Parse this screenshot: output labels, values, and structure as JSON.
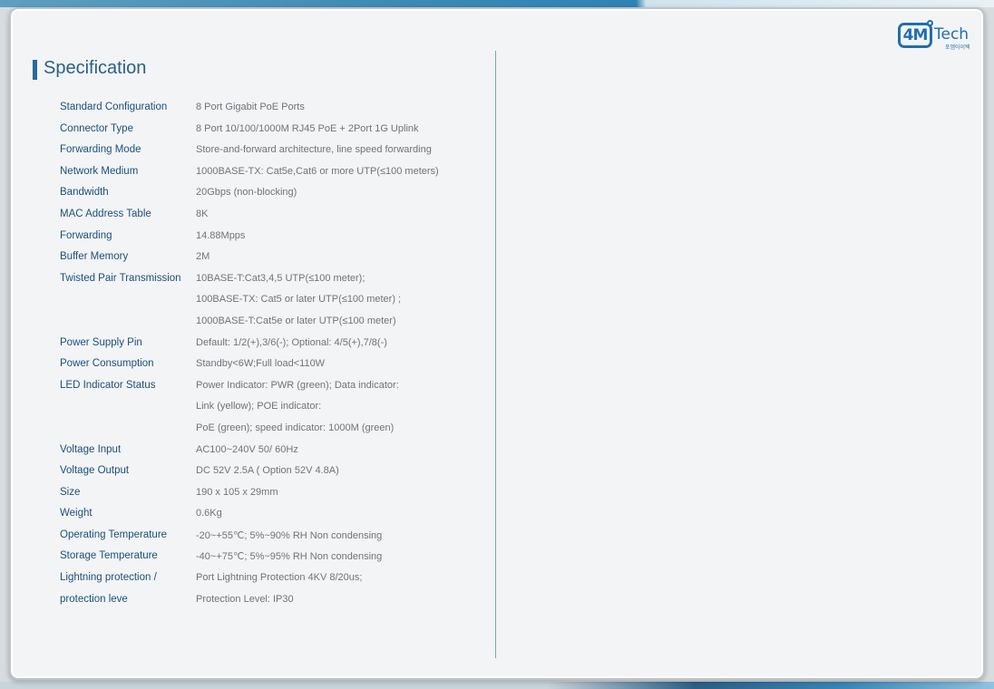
{
  "brand": {
    "logo_mark": "4M",
    "logo_text": "Tech",
    "logo_sub": "포엠아이텍"
  },
  "title": "Specification",
  "colors": {
    "accent": "#2a6a9a",
    "label": "#1d4f7c",
    "value": "#6f7479",
    "divider": "#6fa6cf"
  },
  "specs": [
    {
      "label": "Standard Configuration",
      "value": "8 Port Gigabit PoE Ports"
    },
    {
      "label": "Connector Type",
      "value": "8 Port 10/100/1000M  RJ45 PoE + 2Port 1G Uplink"
    },
    {
      "label": "Forwarding Mode",
      "value": "Store-and-forward architecture, line speed forwarding"
    },
    {
      "label": "Network Medium",
      "value": "1000BASE-TX: Cat5e,Cat6 or more UTP(≤100 meters)"
    },
    {
      "label": "Bandwidth",
      "value": "20Gbps (non-blocking)"
    },
    {
      "label": "MAC Address Table",
      "value": "8K"
    },
    {
      "label": "Forwarding",
      "value": "14.88Mpps"
    },
    {
      "label": "Buffer Memory",
      "value": "2M"
    },
    {
      "label": "Twisted Pair Transmission",
      "value": "10BASE-T:Cat3,4,5  UTP(≤100  meter);"
    },
    {
      "label": "",
      "value": "100BASE-TX: Cat5 or later UTP(≤100 meter) ;"
    },
    {
      "label": "",
      "value": "1000BASE-T:Cat5e or later UTP(≤100 meter)"
    },
    {
      "label": "Power  Supply Pin",
      "value": "Default:  1/2(+),3/6(-);  Optional:  4/5(+),7/8(-)"
    },
    {
      "label": "Power Consumption",
      "value": "Standby<6W;Full  load<110W"
    },
    {
      "label": "LED Indicator Status",
      "value": "Power  Indicator:  PWR  (green);  Data  indicator:"
    },
    {
      "label": "",
      "value": "Link (yellow);  POE  indicator:"
    },
    {
      "label": "",
      "value": "PoE (green);  speed  indicator:  1000M  (green)"
    },
    {
      "label": "Voltage Input",
      "value": "AC100~240V 50/ 60Hz"
    },
    {
      "label": "Voltage Output",
      "value": "DC 52V 2.5A ( Option 52V 4.8A)"
    },
    {
      "label": "Size",
      "value": "190 x 105 x 29mm"
    },
    {
      "label": "Weight",
      "value": "0.6Kg"
    },
    {
      "label": "Operating Temperature",
      "value": "-20~+55℃; 5%~90%  RH  Non  condensing"
    },
    {
      "label": "Storage Temperature",
      "value": "-40~+75℃; 5%~95%  RH  Non  condensing"
    },
    {
      "label": "Lightning protection  /",
      "value": "Port  Lightning  Protection  4KV  8/20us;"
    },
    {
      "label": "protection leve",
      "value": "Protection  Level:  IP30"
    }
  ]
}
